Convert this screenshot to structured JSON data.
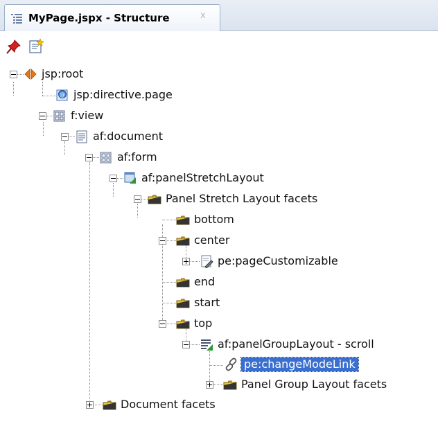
{
  "tab": {
    "title": "MyPage.jspx - Structure",
    "close": "x"
  },
  "toolbar": {
    "buttons": [
      {
        "icon": "pin-icon"
      },
      {
        "icon": "freeze-view-icon"
      }
    ]
  },
  "tree": {
    "selected": "pe:changeModeLink",
    "nodes": [
      {
        "label": "jsp:root",
        "icon": "jsp-root-icon"
      },
      {
        "label": "jsp:directive.page",
        "icon": "directive-icon"
      },
      {
        "label": "f:view",
        "icon": "view-icon"
      },
      {
        "label": "af:document",
        "icon": "document-icon"
      },
      {
        "label": "af:form",
        "icon": "form-icon"
      },
      {
        "label": "af:panelStretchLayout",
        "icon": "layout-icon"
      },
      {
        "label": "Panel Stretch Layout facets",
        "icon": "folder-icon"
      },
      {
        "label": "bottom",
        "icon": "folder-icon"
      },
      {
        "label": "center",
        "icon": "folder-icon"
      },
      {
        "label": "pe:pageCustomizable",
        "icon": "customizable-icon"
      },
      {
        "label": "end",
        "icon": "folder-icon"
      },
      {
        "label": "start",
        "icon": "folder-icon"
      },
      {
        "label": "top",
        "icon": "folder-icon"
      },
      {
        "label": "af:panelGroupLayout - scroll",
        "icon": "group-layout-icon"
      },
      {
        "label": "pe:changeModeLink",
        "icon": "link-icon"
      },
      {
        "label": "Panel Group Layout facets",
        "icon": "folder-icon"
      },
      {
        "label": "Document facets",
        "icon": "folder-icon"
      }
    ]
  }
}
